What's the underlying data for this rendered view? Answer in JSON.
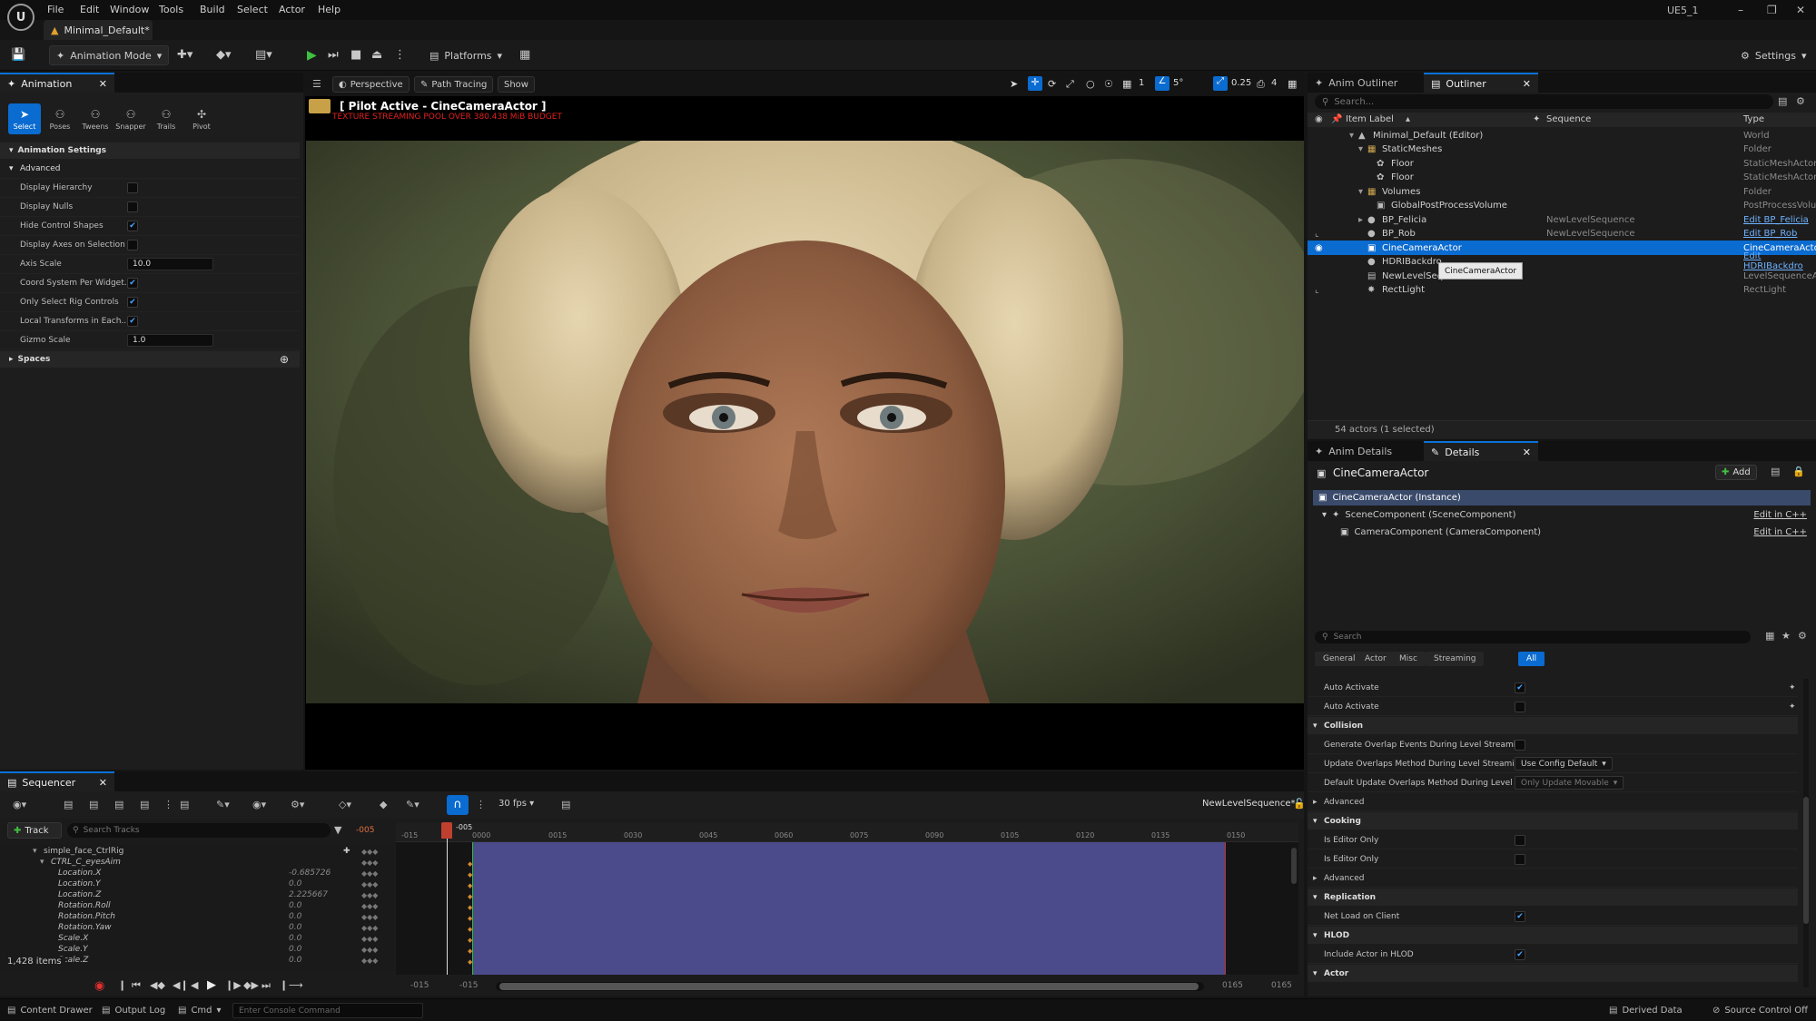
{
  "app": {
    "logo_text": "U",
    "project_name": "UE5_1",
    "document_tab": "Minimal_Default*",
    "menu": [
      "File",
      "Edit",
      "Window",
      "Tools",
      "Build",
      "Select",
      "Actor",
      "Help"
    ]
  },
  "toolbar": {
    "mode_label": "Animation Mode",
    "platforms_label": "Platforms",
    "settings_label": "Settings"
  },
  "animation_panel": {
    "tab_label": "Animation",
    "tools": [
      "Select",
      "Poses",
      "Tweens",
      "Snapper",
      "Trails",
      "Pivot"
    ],
    "section_title": "Animation Settings",
    "subsection_advanced": "Advanced",
    "properties": [
      {
        "label": "Display Hierarchy",
        "checked": false
      },
      {
        "label": "Display Nulls",
        "checked": false
      },
      {
        "label": "Hide Control Shapes",
        "checked": true
      },
      {
        "label": "Display Axes on Selection",
        "checked": false
      },
      {
        "label": "Axis Scale",
        "value": "10.0"
      },
      {
        "label": "Coord System Per Widget...",
        "checked": true
      },
      {
        "label": "Only Select Rig Controls",
        "checked": true
      },
      {
        "label": "Local Transforms in Each...",
        "checked": true
      },
      {
        "label": "Gizmo Scale",
        "value": "1.0"
      }
    ],
    "spaces_label": "Spaces"
  },
  "viewport": {
    "perspective_label": "Perspective",
    "path_tracing_label": "Path Tracing",
    "show_label": "Show",
    "pilot_label": "[ Pilot Active - CineCameraActor ]",
    "warning_text": "TEXTURE STREAMING POOL OVER 380.438 MiB BUDGET",
    "snap_angle": "5°",
    "scale_snap": "0.25",
    "camera_speed": "4",
    "grid_value": "1",
    "grid_snap": "5"
  },
  "outliner": {
    "tab_anim": "Anim Outliner",
    "tab_outliner": "Outliner",
    "search_placeholder": "Search...",
    "col_label": "Item Label",
    "col_sequence": "Sequence",
    "col_type": "Type",
    "rows": [
      {
        "label": "Minimal_Default (Editor)",
        "sequence": "",
        "type": "World"
      },
      {
        "label": "StaticMeshes",
        "sequence": "",
        "type": "Folder"
      },
      {
        "label": "Floor",
        "sequence": "",
        "type": "StaticMeshActor"
      },
      {
        "label": "Floor",
        "sequence": "",
        "type": "StaticMeshActor"
      },
      {
        "label": "Volumes",
        "sequence": "",
        "type": "Folder"
      },
      {
        "label": "GlobalPostProcessVolume",
        "sequence": "",
        "type": "PostProcessVolu"
      },
      {
        "label": "BP_Felicia",
        "sequence": "NewLevelSequence",
        "type": "Edit BP_Felicia"
      },
      {
        "label": "BP_Rob",
        "sequence": "NewLevelSequence",
        "type": "Edit BP_Rob"
      },
      {
        "label": "CineCameraActor",
        "sequence": "",
        "type": "CineCameraActor"
      },
      {
        "label": "HDRIBackdro",
        "sequence": "",
        "type": "Edit HDRIBackdro"
      },
      {
        "label": "NewLevelSeq",
        "sequence": "",
        "type": "LevelSequenceAc"
      },
      {
        "label": "RectLight",
        "sequence": "",
        "type": "RectLight"
      }
    ],
    "tooltip": "CineCameraActor",
    "footer": "54 actors (1 selected)"
  },
  "details": {
    "tab_anim": "Anim Details",
    "tab_details": "Details",
    "actor_name": "CineCameraActor",
    "add_label": "Add",
    "components": [
      {
        "label": "CineCameraActor (Instance)",
        "action": ""
      },
      {
        "label": "SceneComponent (SceneComponent)",
        "action": "Edit in C++"
      },
      {
        "label": "CameraComponent (CameraComponent)",
        "action": "Edit in C++"
      }
    ],
    "search_placeholder": "Search",
    "filters": [
      "General",
      "Actor",
      "Misc",
      "Streaming",
      "All"
    ],
    "active_filter": "All",
    "rows": [
      {
        "kind": "prop",
        "label": "Auto Activate",
        "checked": true
      },
      {
        "kind": "prop",
        "label": "Auto Activate",
        "checked": false
      },
      {
        "kind": "section",
        "label": "Collision"
      },
      {
        "kind": "prop",
        "label": "Generate Overlap Events During Level Streaming",
        "checked": false
      },
      {
        "kind": "prop",
        "label": "Update Overlaps Method During Level Streaming",
        "dropdown": "Use Config Default"
      },
      {
        "kind": "prop",
        "label": "Default Update Overlaps Method During Level Str...",
        "dropdown": "Only Update Movable"
      },
      {
        "kind": "sub",
        "label": "Advanced"
      },
      {
        "kind": "section",
        "label": "Cooking"
      },
      {
        "kind": "prop",
        "label": "Is Editor Only",
        "checked": false
      },
      {
        "kind": "prop",
        "label": "Is Editor Only",
        "checked": false
      },
      {
        "kind": "sub",
        "label": "Advanced"
      },
      {
        "kind": "section",
        "label": "Replication"
      },
      {
        "kind": "prop",
        "label": "Net Load on Client",
        "checked": true
      },
      {
        "kind": "section",
        "label": "HLOD"
      },
      {
        "kind": "prop",
        "label": "Include Actor in HLOD",
        "checked": true
      },
      {
        "kind": "section",
        "label": "Actor"
      }
    ]
  },
  "sequencer": {
    "tab_label": "Sequencer",
    "track_button": "Track",
    "search_placeholder": "Search Tracks",
    "current_frame": "-005",
    "fps_label": "30 fps",
    "sequence_name": "NewLevelSequence*",
    "ruler_labels": [
      "-015",
      "0000",
      "0015",
      "0030",
      "0045",
      "0060",
      "0075",
      "0090",
      "0105",
      "0120",
      "0135",
      "0150"
    ],
    "playhead_label": "-005",
    "tracks": [
      {
        "label": "simple_face_CtrlRig",
        "value": "",
        "level": 0
      },
      {
        "label": "CTRL_C_eyesAim",
        "value": "",
        "level": 1
      },
      {
        "label": "Location.X",
        "value": "-0.685726",
        "level": 2
      },
      {
        "label": "Location.Y",
        "value": "0.0",
        "level": 2
      },
      {
        "label": "Location.Z",
        "value": "2.225667",
        "level": 2
      },
      {
        "label": "Rotation.Roll",
        "value": "0.0",
        "level": 2
      },
      {
        "label": "Rotation.Pitch",
        "value": "0.0",
        "level": 2
      },
      {
        "label": "Rotation.Yaw",
        "value": "0.0",
        "level": 2
      },
      {
        "label": "Scale.X",
        "value": "0.0",
        "level": 2
      },
      {
        "label": "Scale.Y",
        "value": "0.0",
        "level": 2
      },
      {
        "label": "Scale.Z",
        "value": "0.0",
        "level": 2
      }
    ],
    "items_count": "1,428 items",
    "range_start_a": "-015",
    "range_start_b": "-015",
    "range_end_a": "0165",
    "range_end_b": "0165"
  },
  "statusbar": {
    "content_drawer": "Content Drawer",
    "output_log": "Output Log",
    "cmd": "Cmd",
    "console_placeholder": "Enter Console Command",
    "derived_data": "Derived Data",
    "source_control": "Source Control Off"
  },
  "colors": {
    "accent": "#0a6bd0",
    "sequence_range": "#4b4a8a",
    "warning": "#e02020"
  }
}
